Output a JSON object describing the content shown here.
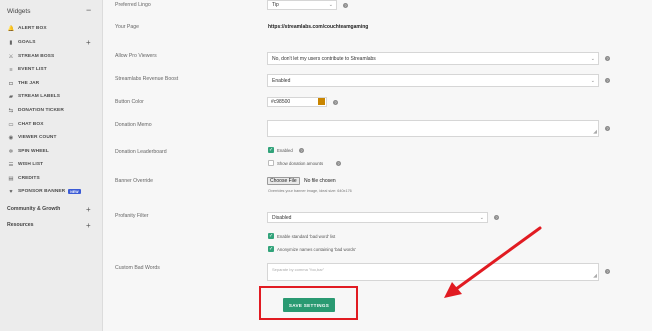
{
  "sidebar": {
    "header": "Widgets",
    "collapse_glyph": "−",
    "items": [
      {
        "label": "ALERT BOX",
        "icon": "bell-icon",
        "glyph": "🔔"
      },
      {
        "label": "GOALS",
        "icon": "chart-icon",
        "glyph": "▮",
        "plus": "+"
      },
      {
        "label": "STREAM BOSS",
        "icon": "sword-icon",
        "glyph": "⚔"
      },
      {
        "label": "EVENT LIST",
        "icon": "list-icon",
        "glyph": "≡"
      },
      {
        "label": "THE JAR",
        "icon": "jar-icon",
        "glyph": "◘"
      },
      {
        "label": "STREAM LABELS",
        "icon": "tag-icon",
        "glyph": "▰"
      },
      {
        "label": "DONATION TICKER",
        "icon": "ticker-icon",
        "glyph": "⇆"
      },
      {
        "label": "CHAT BOX",
        "icon": "chat-icon",
        "glyph": "▭"
      },
      {
        "label": "VIEWER COUNT",
        "icon": "eye-icon",
        "glyph": "◉"
      },
      {
        "label": "SPIN WHEEL",
        "icon": "wheel-icon",
        "glyph": "✲"
      },
      {
        "label": "WISH LIST",
        "icon": "wishlist-icon",
        "glyph": "☰"
      },
      {
        "label": "CREDITS",
        "icon": "credits-icon",
        "glyph": "▤"
      },
      {
        "label": "SPONSOR BANNER",
        "icon": "heart-icon",
        "glyph": "♥",
        "badge": "NEW"
      }
    ],
    "sections": [
      {
        "label": "Community & Growth",
        "plus": "+"
      },
      {
        "label": "Resources",
        "plus": "+"
      }
    ]
  },
  "form": {
    "preferred_lingo": {
      "label": "Preferred Lingo",
      "value": "Tip"
    },
    "your_page": {
      "label": "Your Page",
      "value": "https://streamlabs.com/couchteamgaming"
    },
    "allow_pro_viewers": {
      "label": "Allow Pro Viewers",
      "value": "No, don't let my users contribute to Streamlabs"
    },
    "rewards_boost": {
      "label": "Streamlabs Revenue Boost",
      "value": "Enabled"
    },
    "button_color": {
      "label": "Button Color",
      "value": "#c98500",
      "swatch": "#c98500"
    },
    "donation_memo": {
      "label": "Donation Memo"
    },
    "donation_leaderboard": {
      "label": "Donation Leaderboard",
      "enabled_label": "Enabled",
      "show_amounts_label": "Show donation amounts"
    },
    "banner_override": {
      "label": "Banner Override",
      "button": "Choose File",
      "no_file": "No file chosen",
      "hint": "Overrides your banner image, ideal size: 640x176"
    },
    "profanity_filter": {
      "label": "Profanity Filter",
      "value": "Disabled",
      "option1": "Enable standard 'bad word' list",
      "option2": "Anonymize names containing 'bad words'"
    },
    "custom_bad_words": {
      "label": "Custom Bad Words",
      "placeholder": "Separate by comma \"foo,bar\""
    },
    "help_glyph": "?",
    "check_glyph": "✓",
    "chevron_glyph": "⌄"
  },
  "save_button": "SAVE SETTINGS",
  "annotation": {
    "color": "#e11b22"
  }
}
